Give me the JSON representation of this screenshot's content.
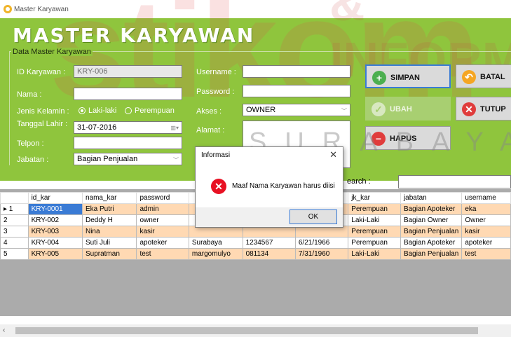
{
  "window": {
    "title": "Master Karyawan"
  },
  "header": {
    "title": "MASTER KARYAWAN",
    "group_label": "Data Master Karyawan"
  },
  "watermark": {
    "brand": "stikom",
    "subtitle": "SURABAYA",
    "tail": "& INFORMA"
  },
  "form": {
    "id_label": "ID Karyawan :",
    "id_value": "KRY-006",
    "nama_label": "Nama :",
    "nama_value": "",
    "jk_label": "Jenis Kelamin :",
    "jk_opt1": "Laki-laki",
    "jk_opt2": "Perempuan",
    "tgl_label": "Tanggal Lahir :",
    "tgl_value": "31-07-2016",
    "telp_label": "Telpon :",
    "telp_value": "",
    "jabatan_label": "Jabatan :",
    "jabatan_value": "Bagian Penjualan",
    "username_label": "Username :",
    "username_value": "",
    "password_label": "Password :",
    "password_value": "",
    "akses_label": "Akses :",
    "akses_value": "OWNER",
    "alamat_label": "Alamat :",
    "alamat_value": ""
  },
  "buttons": {
    "simpan": "SIMPAN",
    "batal": "BATAL",
    "ubah": "UBAH",
    "tutup": "TUTUP",
    "hapus": "HAPUS"
  },
  "search": {
    "label": "earch :",
    "value": ""
  },
  "table": {
    "columns": [
      "id_kar",
      "nama_kar",
      "password",
      "",
      "",
      "",
      "jk_kar",
      "jabatan",
      "username"
    ],
    "rows": [
      {
        "marker": "▸ 1",
        "cells": [
          "KRY-0001",
          "Eka Putri",
          "admin",
          "",
          "",
          "",
          "Perempuan",
          "Bagian Apoteker",
          "eka"
        ]
      },
      {
        "marker": "2",
        "cells": [
          "KRY-002",
          "Deddy H",
          "owner",
          "",
          "",
          "",
          "Laki-Laki",
          "Bagian Owner",
          "Owner"
        ]
      },
      {
        "marker": "3",
        "cells": [
          "KRY-003",
          "Nina",
          "kasir",
          "",
          "",
          "",
          "Perempuan",
          "Bagian Penjualan",
          "kasir"
        ]
      },
      {
        "marker": "4",
        "cells": [
          "KRY-004",
          "Suti Juli",
          "apoteker",
          "Surabaya",
          "1234567",
          "6/21/1966",
          "Perempuan",
          "Bagian Apoteker",
          "apoteker"
        ]
      },
      {
        "marker": "5",
        "cells": [
          "KRY-005",
          "Supratman",
          "test",
          "margomulyo",
          "081134",
          "7/31/1960",
          "Laki-Laki",
          "Bagian Penjualan",
          "test"
        ]
      }
    ]
  },
  "dialog": {
    "title": "Informasi",
    "message": "Maaf Nama Karyawan harus diisi",
    "ok": "OK"
  },
  "colors": {
    "panel": "#8fc53d",
    "row_alt": "#ffd9b3",
    "selection": "#3a7bd5",
    "error": "#e81123"
  }
}
